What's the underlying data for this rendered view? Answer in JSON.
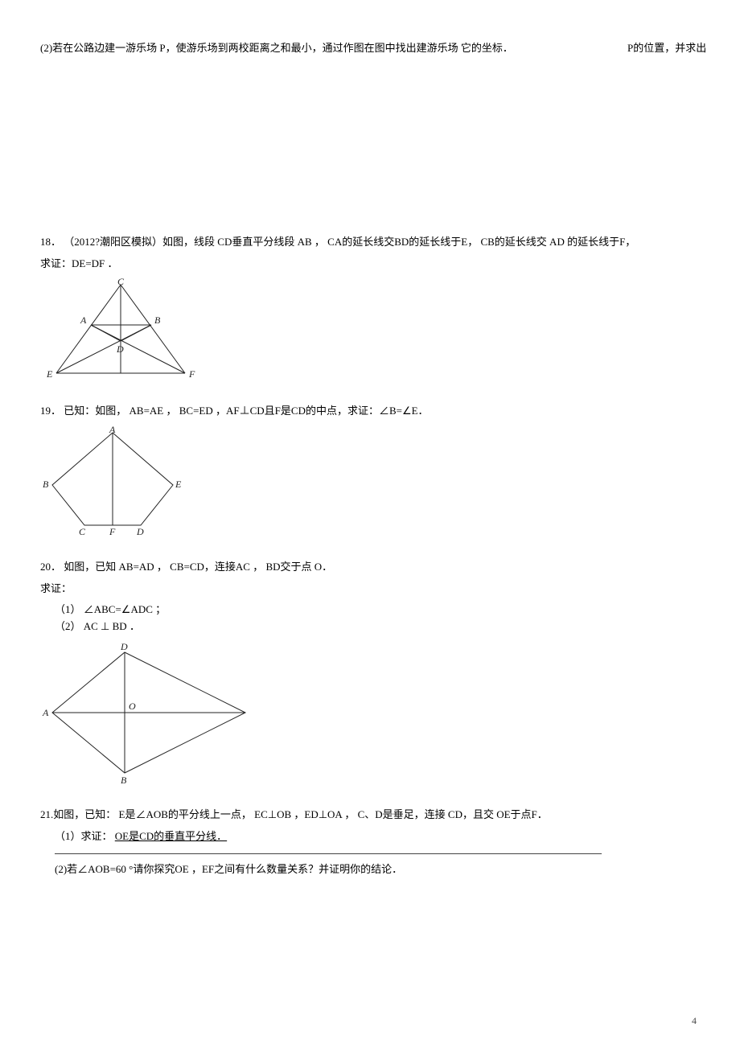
{
  "q17": {
    "part2_left": "(2)若在公路边建一游乐场 P，使游乐场到两校距离之和最小，通过作图在图中找出建游乐场 它的坐标．",
    "part2_right": "P的位置，并求出"
  },
  "q18": {
    "num": "18．",
    "text": "（2012?潮阳区模拟）如图，线段 CD垂直平分线段 AB ， CA的延长线交BD的延长线于E， CB的延长线交 AD 的延长线于F，",
    "prove": "求证：DE=DF ．",
    "labels": {
      "C": "C",
      "A": "A",
      "B": "B",
      "D": "D",
      "E": "E",
      "F": "F"
    }
  },
  "q19": {
    "num": "19．",
    "text": "已知：如图， AB=AE ， BC=ED ，AF⊥CD且F是CD的中点，求证：∠B=∠E．",
    "labels": {
      "A": "A",
      "B": "B",
      "E": "E",
      "C": "C",
      "F": "F",
      "D": "D"
    }
  },
  "q20": {
    "num": "20．",
    "text": "如图，已知 AB=AD ， CB=CD，连接AC ， BD交于点 O．",
    "prove_lead": "求证：",
    "sub1": "（1）  ∠ABC=∠ADC ；",
    "sub2": "（2）  AC ⊥ BD ．",
    "labels": {
      "D": "D",
      "O": "O",
      "A": "A",
      "B": "B"
    }
  },
  "q21": {
    "num_text": "21.如图，已知： E是∠AOB的平分线上一点， EC⊥OB ，ED⊥OA ， C、D是垂足，连接 CD，且交 OE于点F．",
    "sub1_lead": "（1）求证：",
    "sub1_text": "OE是CD的垂直平分线．",
    "sub2": "(2)若∠AOB=60 °请你探究OE ，EF之间有什么数量关系？并证明你的结论．"
  },
  "page_number": "4"
}
